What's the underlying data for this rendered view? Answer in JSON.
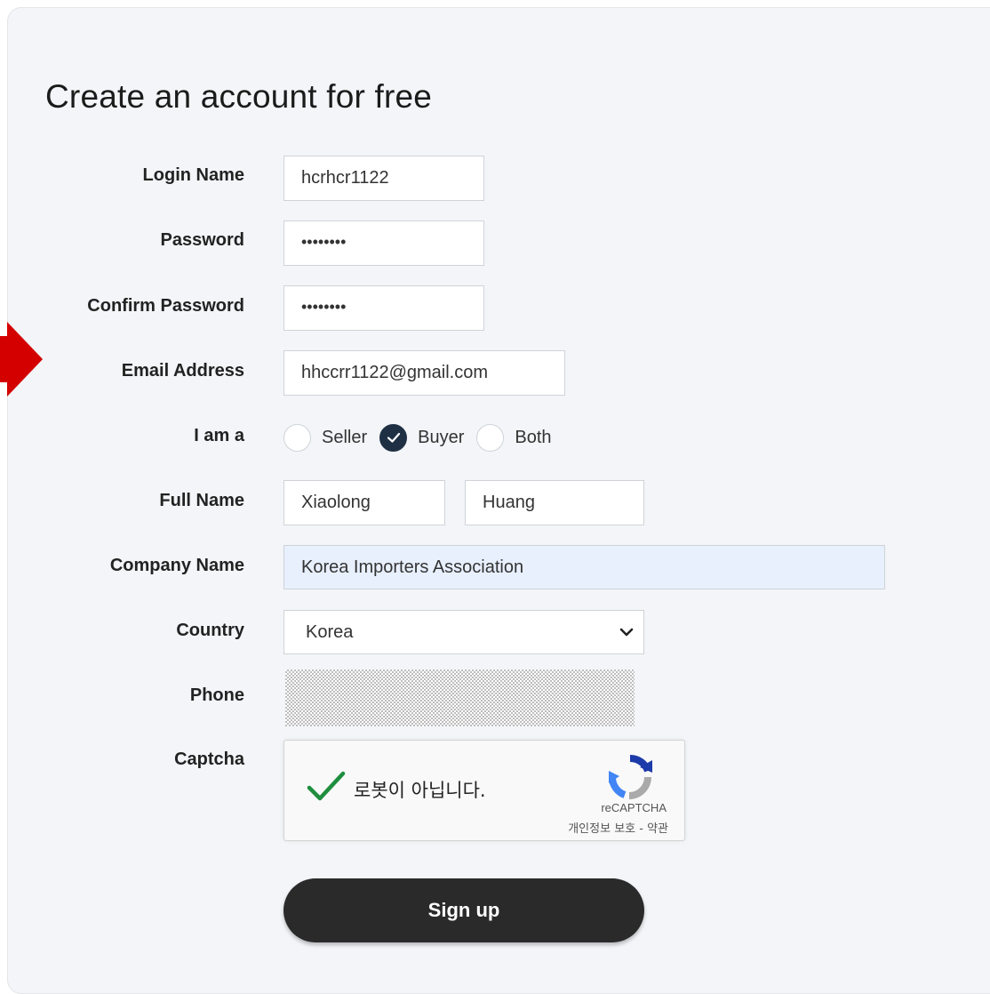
{
  "form": {
    "title": "Create an account for free",
    "login_name": {
      "label": "Login Name",
      "value": "hcrhcr1122"
    },
    "password": {
      "label": "Password",
      "value": "••••••••"
    },
    "confirm_password": {
      "label": "Confirm Password",
      "value": "••••••••"
    },
    "email": {
      "label": "Email Address",
      "value": "hhccrr1122@gmail.com"
    },
    "role": {
      "label": "I am a",
      "options": [
        {
          "label": "Seller",
          "checked": false
        },
        {
          "label": "Buyer",
          "checked": true
        },
        {
          "label": "Both",
          "checked": false
        }
      ]
    },
    "full_name": {
      "label": "Full Name",
      "first": "Xiaolong",
      "last": "Huang"
    },
    "company_name": {
      "label": "Company Name",
      "value": "Korea Importers Association"
    },
    "country": {
      "label": "Country",
      "selected": "Korea"
    },
    "phone": {
      "label": "Phone"
    },
    "captcha": {
      "label": "Captcha",
      "status_text": "로봇이 아닙니다.",
      "brand": "reCAPTCHA",
      "links": "개인정보 보호 - 약관"
    },
    "submit_label": "Sign up"
  },
  "colors": {
    "card_bg": "#f3f5f8",
    "selected_radio": "#1f3044",
    "autofill_bg": "#e8f0fe",
    "captcha_check": "#1e8e3e",
    "pointer_arrow": "#d40000",
    "button_bg": "#2a2a2a"
  },
  "icons": [
    "pointer-arrow-icon",
    "checkmark-icon",
    "chevron-down-icon",
    "captcha-check-icon",
    "recaptcha-logo-icon"
  ]
}
